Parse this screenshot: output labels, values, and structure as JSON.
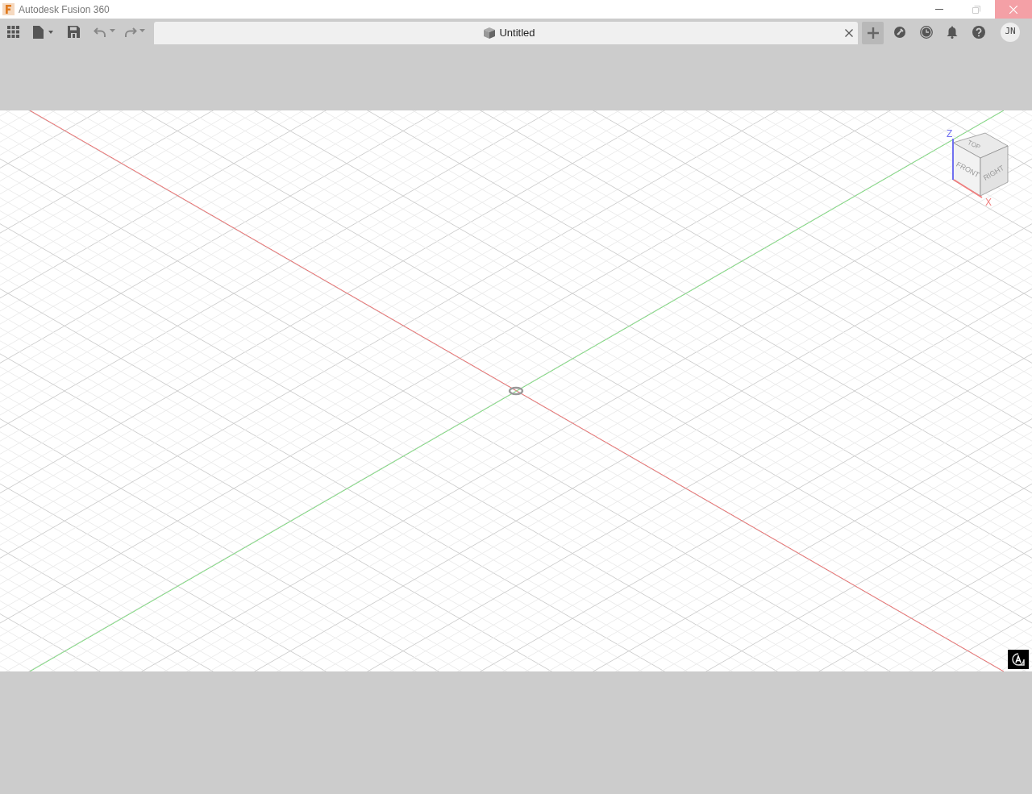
{
  "window": {
    "title": "Autodesk Fusion 360"
  },
  "document_tab": {
    "title": "Untitled"
  },
  "user": {
    "initials": "JN"
  },
  "view_cube": {
    "faces": [
      "TOP",
      "FRONT",
      "RIGHT"
    ],
    "axes": [
      "Z",
      "X"
    ]
  }
}
